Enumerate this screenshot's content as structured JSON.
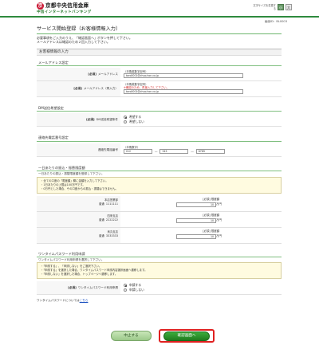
{
  "header": {
    "logo_mark": "京",
    "bank_name": "京都中央信用金庫",
    "service_name": "中信インターネットバンキング",
    "fontsize_label": "文字サイズを変更する",
    "font_small": "小",
    "font_large": "大",
    "screen_id": "画面ID：BL0003"
  },
  "page": {
    "title": "サービス開始登録（お客様情報入力）",
    "intro": [
      "必要事項をご入力のうえ、「確認画面へ」ボタンを押して下さい。",
      "メールアドレスは確認のため２回入力して下さい。"
    ],
    "section_title": "お客様情報の入力"
  },
  "email": {
    "title": "メールアドレス設定",
    "req": "[必須]",
    "label1": "メールアドレス",
    "hint1": "（半角英数字記号）",
    "value1": "taro0001@chuo.hon.co.jp",
    "label2": "メールアドレス（再入力）",
    "hint2": "（半角英数字記号）",
    "warn2": "※確認のため、再度入力して下さい。",
    "value2": "taro0001@chuo.hon.co.jp"
  },
  "dm": {
    "title": "DM送信希望設定",
    "req": "[必須]",
    "label": "DM送信希望条件",
    "options": [
      "希望する",
      "希望しない"
    ]
  },
  "phone": {
    "title": "連絡先電話番号設定",
    "label": "連絡先電話番号",
    "hint": "（半角数字）",
    "part1": "012",
    "part2": "345",
    "part3": "6789",
    "sep": "―"
  },
  "limits": {
    "title": "一日あたりの振込・振替限度額",
    "desc": "一日あたりの振込・振替限度額を登録して下さい。",
    "notes": [
      "全ての口座の「限度額」欄に金額を入力して下さい。",
      "1日あたりの上限は100万円です。",
      "0万円とした場合、その口座からの振込・振替はできません。"
    ],
    "req": "[必須]",
    "limit_label": "限度額",
    "unit": "万円",
    "accounts": [
      {
        "branch": "本店営業部",
        "type": "普通",
        "number": "1111111",
        "value": "10"
      },
      {
        "branch": "四条支店",
        "type": "普通",
        "number": "2222222",
        "value": "10"
      },
      {
        "branch": "烏丸支店",
        "type": "普通",
        "number": "3333333",
        "value": "10"
      }
    ]
  },
  "otp": {
    "title": "ワンタイムパスワード利用申請",
    "desc": "ワンタイムパスワード利用申請を選択して下さい。",
    "notes": [
      "「申請する」、「申請しない」をご選択下さい。",
      "「申請する」を選択した場合、ワンタイムパスワード申請内容選択画面へ遷移します。",
      "「申請しない」を選択した場合、トップページへ遷移します。"
    ],
    "req": "[必須]",
    "label": "ワンタイムパスワード利用申請",
    "options": [
      "申請する",
      "申請しない"
    ],
    "footer_text": "ワンタイムパスワードについては",
    "footer_link": "こちら"
  },
  "buttons": {
    "back": "中止する",
    "next": "確認画面へ"
  },
  "colors": {
    "brand_green": "#2e8b3e",
    "brand_red": "#c8102e",
    "highlight_red": "#e02020"
  }
}
